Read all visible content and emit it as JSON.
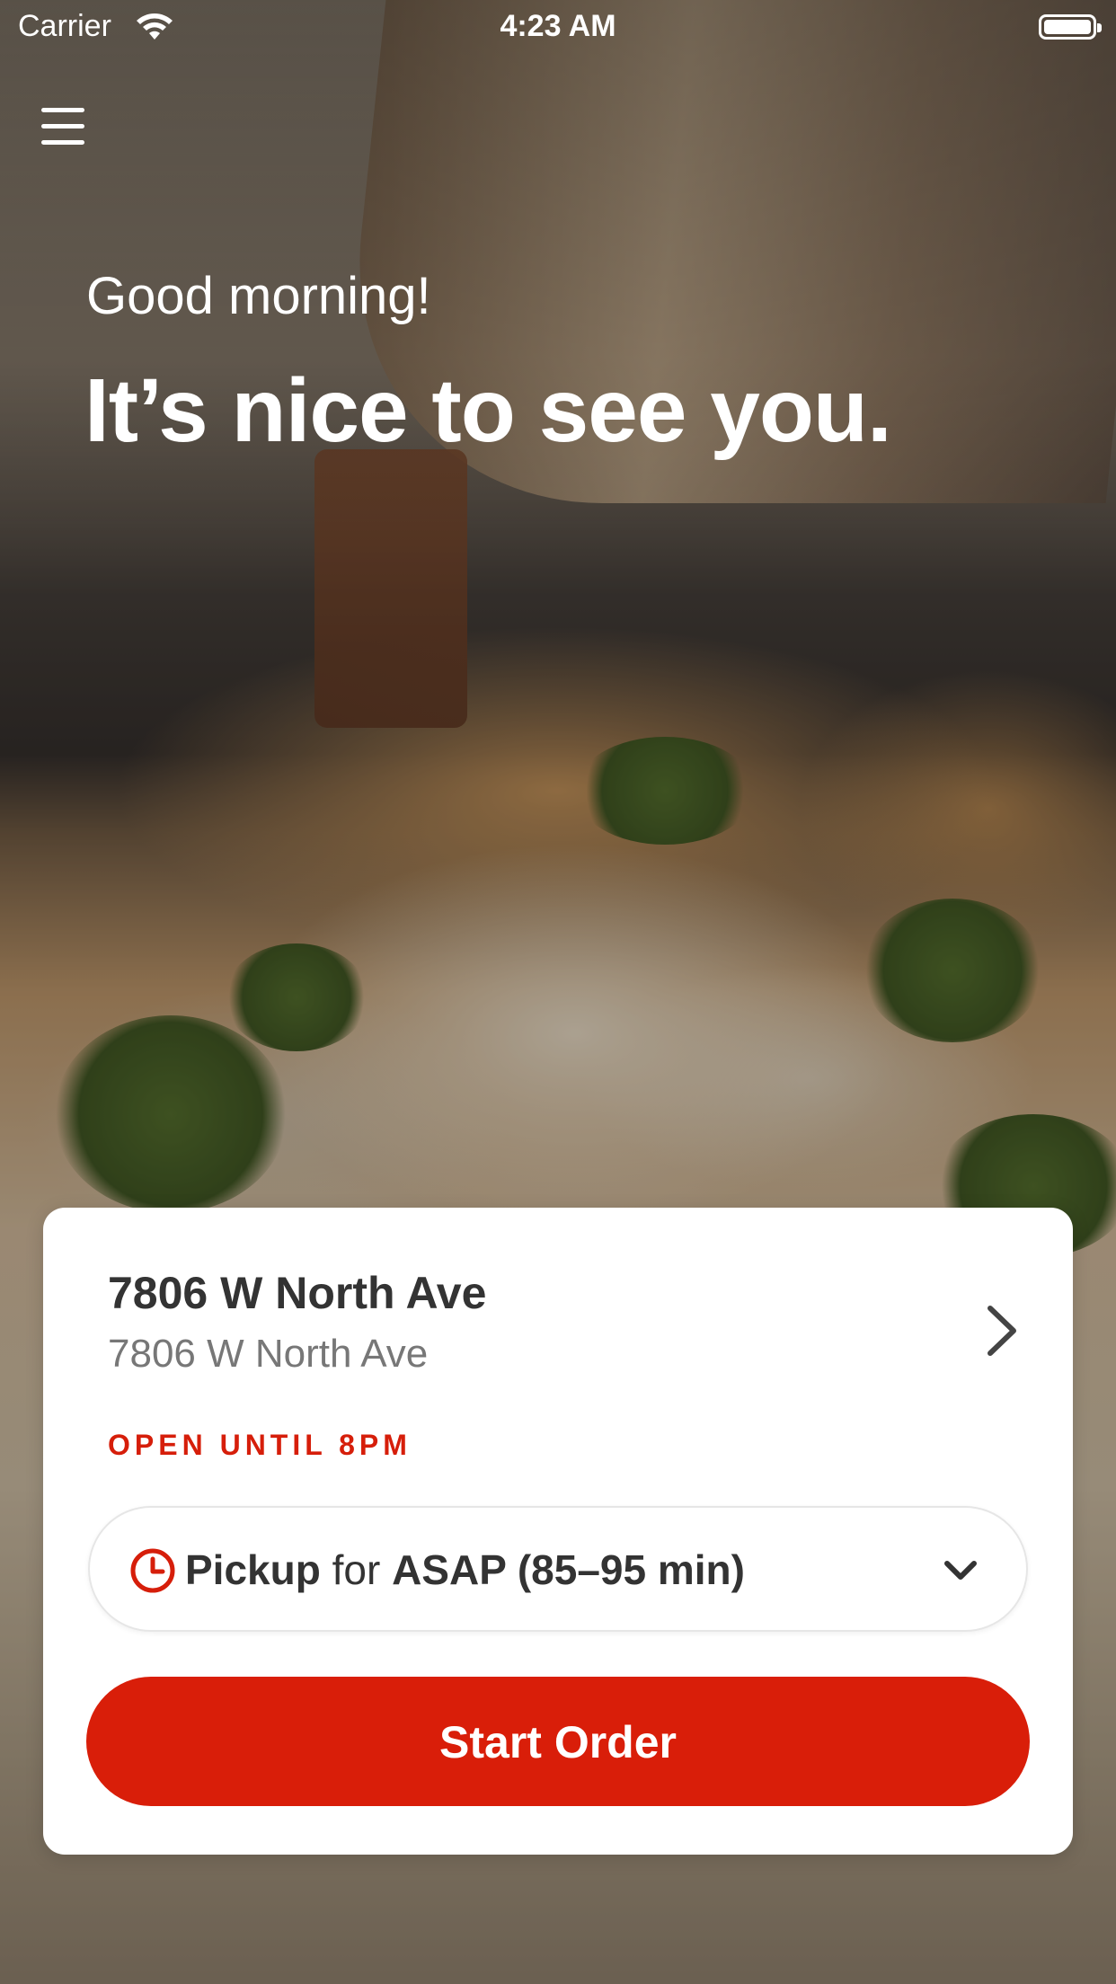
{
  "status_bar": {
    "carrier": "Carrier",
    "time": "4:23 AM"
  },
  "hero": {
    "greeting": "Good morning!",
    "headline": "It’s nice to see you."
  },
  "store": {
    "name": "7806 W North Ave",
    "address": "7806 W North Ave",
    "open_status": "OPEN UNTIL 8PM"
  },
  "order_mode": {
    "method": "Pickup",
    "connector": "for",
    "time": "ASAP (85–95 min)"
  },
  "start_order_label": "Start Order",
  "colors": {
    "accent": "#d91e09",
    "status": "#d61e0a",
    "card": "#ffffff"
  },
  "icons": [
    "hamburger-menu-icon",
    "wifi-icon",
    "battery-icon",
    "chevron-right-icon",
    "clock-icon",
    "chevron-down-icon"
  ]
}
